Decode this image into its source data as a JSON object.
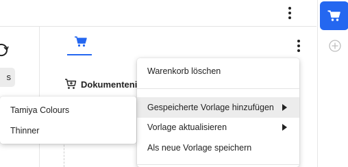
{
  "menu": {
    "items": [
      {
        "label": "Warenkorb löschen"
      },
      {
        "label": "Gespeicherte Vorlage hinzufügen",
        "has_submenu": true,
        "active": true
      },
      {
        "label": "Vorlage aktualisieren",
        "has_submenu": true
      },
      {
        "label": "Als neue Vorlage speichern"
      }
    ]
  },
  "submenu": {
    "items": [
      {
        "label": "Tamiya Colours"
      },
      {
        "label": "Thinner"
      }
    ]
  },
  "main": {
    "doc_title": "Dokumenteni",
    "tab_icon": "cart-icon"
  },
  "left": {
    "chip_label": "s",
    "refresh_icon": "refresh-icon"
  },
  "rightbar": {
    "cart_icon": "cart-icon",
    "add_icon": "plus-circle-icon"
  },
  "colors": {
    "accent": "#2467f0",
    "menu_active_bg": "#ececec"
  }
}
